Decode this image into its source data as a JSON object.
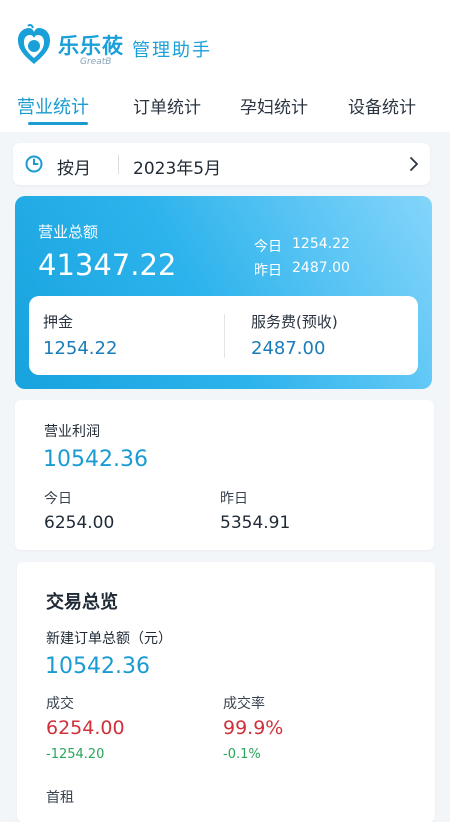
{
  "header": {
    "logo_text": "乐乐莜",
    "logo_sub": "GreatB",
    "app_name": "管理助手"
  },
  "tabs": [
    {
      "label": "营业统计",
      "active": true
    },
    {
      "label": "订单统计",
      "active": false
    },
    {
      "label": "孕妇统计",
      "active": false
    },
    {
      "label": "设备统计",
      "active": false
    }
  ],
  "month_selector": {
    "icon": "clock-icon",
    "mode": "按月",
    "date": "2023年5月"
  },
  "revenue": {
    "title": "营业总额",
    "total": "41347.22",
    "today_label": "今日",
    "today_value": "1254.22",
    "yesterday_label": "昨日",
    "yesterday_value": "2487.00",
    "deposit_label": "押金",
    "deposit_value": "1254.22",
    "service_label": "服务费(预收)",
    "service_value": "2487.00"
  },
  "profit": {
    "title": "营业利润",
    "value": "10542.36",
    "today_label": "今日",
    "today_value": "6254.00",
    "yesterday_label": "昨日",
    "yesterday_value": "5354.91"
  },
  "transactions": {
    "title": "交易总览",
    "new_orders_label": "新建订单总额（元）",
    "new_orders_value": "10542.36",
    "deal_label": "成交",
    "deal_value": "6254.00",
    "deal_delta": "-1254.20",
    "rate_label": "成交率",
    "rate_value": "99.9%",
    "rate_delta": "-0.1%",
    "next_label": "首租"
  },
  "colors": {
    "accent": "#1a9bd2",
    "negative": "#d0303a",
    "delta": "#2aa55a"
  }
}
